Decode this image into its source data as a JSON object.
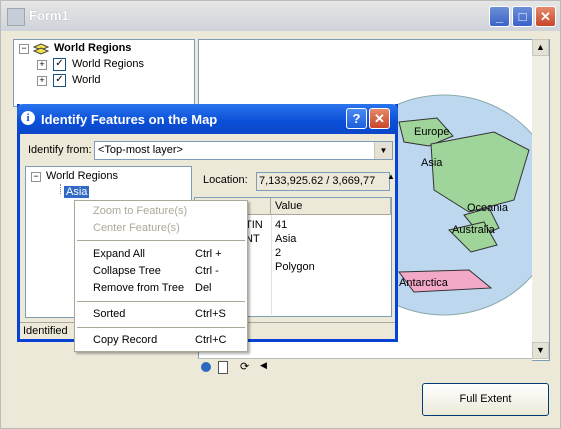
{
  "window": {
    "title": "Form1",
    "min": "_",
    "max": "□",
    "close": "✕"
  },
  "layers_tree": {
    "root": {
      "label": "World Regions",
      "toggle": "−"
    },
    "items": [
      {
        "label": "World Regions",
        "toggle": "+",
        "checked": "✓"
      },
      {
        "label": "World",
        "toggle": "+",
        "checked": "✓"
      }
    ]
  },
  "map": {
    "labels": [
      "Europe",
      "Asia",
      "Oceania",
      "Australia",
      "Antarctica"
    ]
  },
  "full_extent_label": "Full Extent",
  "dialog": {
    "title": "Identify Features on the Map",
    "help": "?",
    "close": "✕",
    "identify_from_label": "Identify from:",
    "identify_from_value": "<Top-most layer>",
    "tree": {
      "root": "World Regions",
      "child": "Asia",
      "toggle": "−"
    },
    "location_label": "Location:",
    "location_value": "7,133,925.62 / 3,669,77",
    "grid": {
      "columns": [
        "Value"
      ],
      "field_fragments": [
        "TIN",
        "NT"
      ],
      "values": [
        "41",
        "Asia",
        "2",
        "Polygon"
      ]
    },
    "status": "Identified"
  },
  "context_menu": {
    "items": [
      {
        "label": "Zoom to Feature(s)",
        "shortcut": "",
        "enabled": false
      },
      {
        "label": "Center Feature(s)",
        "shortcut": "",
        "enabled": false
      },
      {
        "label": "Expand All",
        "shortcut": "Ctrl +",
        "enabled": true
      },
      {
        "label": "Collapse Tree",
        "shortcut": "Ctrl -",
        "enabled": true
      },
      {
        "label": "Remove from Tree",
        "shortcut": "Del",
        "enabled": true
      },
      {
        "label": "Sorted",
        "shortcut": "Ctrl+S",
        "enabled": true
      },
      {
        "label": "Copy Record",
        "shortcut": "Ctrl+C",
        "enabled": true
      }
    ]
  },
  "colors": {
    "title_active": "#0a4ed7",
    "selection": "#316ac5",
    "ocean": "#bcd7ee",
    "land": "#9fd49a"
  }
}
